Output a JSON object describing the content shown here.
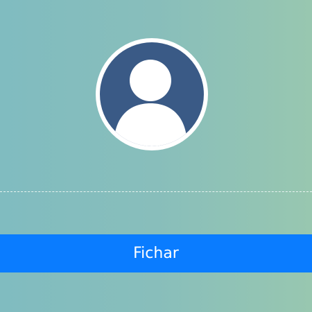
{
  "avatar": {
    "icon": "user-icon"
  },
  "clock_in": {
    "label": "Fichar"
  }
}
